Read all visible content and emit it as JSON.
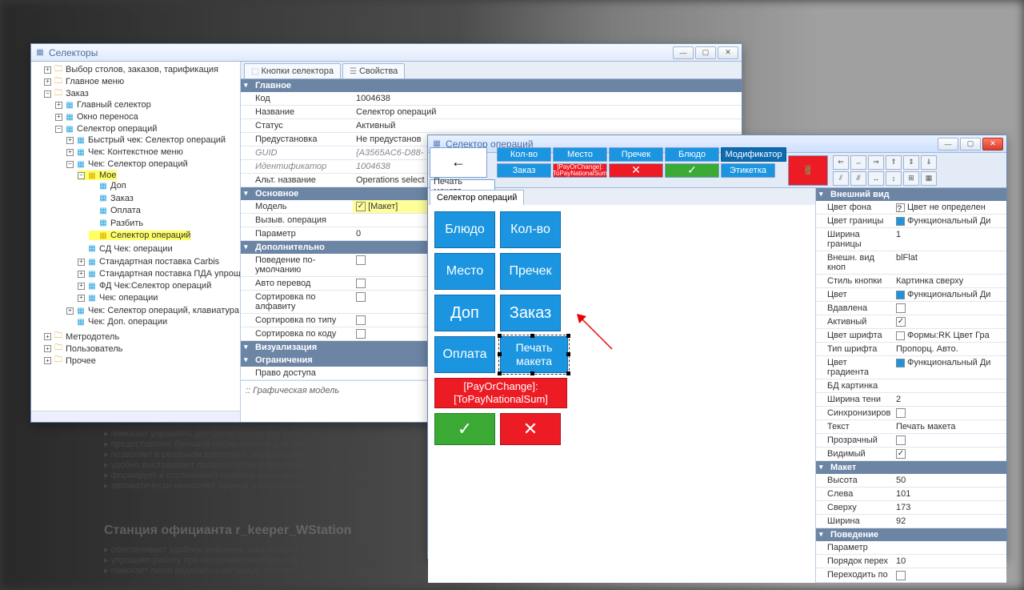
{
  "bg": {
    "bullets1": [
      "помогает управлять доступом персонала к кассовым операци",
      "предоставляет большой набор отчетов для ежедневного контр",
      "позволяет в реальном времени и по расписанию обновлять м",
      "удобно выстраивает правила оплаты по категориям блюд и го",
      "формирует и отслеживает правила начисления скидок",
      "автоматически начисляет премий и штрафы персоналу с учёт"
    ],
    "heading": "Станция официанта r_keeper_WStation",
    "bullets2": [
      "обеспечивает удобное внесение заказа через интуитивно-пон",
      "упрощает работу при обслуживании банкетов и перенос блюд м",
      "помогает легко поделить счет между гостями"
    ]
  },
  "win1": {
    "title": "Селекторы",
    "tree": {
      "n0": "Выбор столов, заказов, тарификация",
      "n1": "Главное меню",
      "n2": "Заказ",
      "n2_0": "Главный селектор",
      "n2_1": "Окно переноса",
      "n2_2": "Селектор операций",
      "n2_2_0": "Быстрый чек: Селектор операций",
      "n2_2_1": "Чек: Контекстное меню",
      "n2_2_2": "Чек: Селектор операций",
      "n2_2_2_0": "Мое",
      "n2_2_2_0_0": "Доп",
      "n2_2_2_0_1": "Заказ",
      "n2_2_2_0_2": "Оплата",
      "n2_2_2_0_3": "Разбить",
      "n2_2_2_0_4": "Селектор операций",
      "n2_2_3": "СД Чек: операции",
      "n2_2_4": "Стандартная поставка Carbis",
      "n2_2_5": "Стандартная поставка ПДА упрощ",
      "n2_2_6": "ФД Чек:Селектор операций",
      "n2_2_7": "Чек: операции",
      "n2_3": "Чек: Селектор операций, клавиатура",
      "n2_4": "Чек: Доп. операции",
      "n3": "Метродотель",
      "n4": "Пользователь",
      "n5": "Прочее"
    },
    "tabs": {
      "t0": "Кнопки селектора",
      "t1": "Свойства"
    },
    "props": {
      "sec_main": "Главное",
      "k_code": "Код",
      "v_code": "1004638",
      "k_name": "Название",
      "v_name": "Селектор операций",
      "k_status": "Статус",
      "v_status": "Активный",
      "k_preset": "Предустановка",
      "v_preset": "Не предустанов",
      "k_guid": "GUID",
      "v_guid": "{A3565AC6-D88-",
      "k_id": "Идентификатор",
      "v_id": "1004638",
      "k_alt": "Альт. название",
      "v_alt": "Operations select",
      "sec_main2": "Основное",
      "k_model": "Модель",
      "v_model": "[Макет]",
      "k_call": "Вызыв. операция",
      "k_param": "Параметр",
      "v_param": "0",
      "sec_extra": "Дополнительно",
      "k_def": "Поведение по-умолчанию",
      "k_auto": "Авто перевод",
      "k_sorta": "Сортировка по алфавиту",
      "k_sortt": "Сортировка по типу",
      "k_sortc": "Сортировка по коду",
      "sec_vis": "Визуализация",
      "sec_lim": "Ограничения",
      "k_access": "Право доступа",
      "graph": ":: Графическая модель"
    }
  },
  "win2": {
    "title": "Селектор операций",
    "toolbar": {
      "r0": {
        "b0": "←",
        "b1": "Кол-во",
        "b2": "Место",
        "b3": "Пречек",
        "b4": "Блюдо",
        "b5": "Модификатор",
        "b6_icon": "door"
      },
      "r1": {
        "b0": "Заказ",
        "b1": "[PayOrChange]:\n[ToPayNationalSum]",
        "b2": "✕",
        "b3": "✓",
        "b4": "Этикетка",
        "b5": "Печать макета"
      }
    },
    "canvas_tab": "Селектор операций",
    "canvas": {
      "b_dish": "Блюдо",
      "b_qty": "Кол-во",
      "b_place": "Место",
      "b_precheck": "Пречек",
      "b_dop": "Доп",
      "b_order": "Заказ",
      "b_pay": "Оплата",
      "b_print": "Печать\nмакета",
      "b_paych": "[PayOrChange]:\n[ToPayNationalSum]",
      "b_ok": "✓",
      "b_cancel": "✕"
    },
    "props": {
      "sec_appear": "Внешний вид",
      "k_bgcolor": "Цвет фона",
      "v_bgcolor": "Цвет не определен",
      "k_border": "Цвет границы",
      "v_border": "Функциональный Ди",
      "k_bw": "Ширина границы",
      "v_bw": "1",
      "k_bevel": "Внешн. вид кноп",
      "v_bevel": "blFlat",
      "k_bstyle": "Стиль кнопки",
      "v_bstyle": "Картинка сверху",
      "k_color": "Цвет",
      "v_color": "Функциональный Ди",
      "k_pressed": "Вдавлена",
      "k_active": "Активный",
      "k_fontc": "Цвет шрифта",
      "v_fontc": "Формы:RK Цвет Гра",
      "k_fontt": "Тип шрифта",
      "v_fontt": "Пропорц. Авто.",
      "k_grad": "Цвет градиента",
      "v_grad": "Функциональный Ди",
      "k_dbpic": "БД картинка",
      "k_shadow": "Ширина тени",
      "v_shadow": "2",
      "k_sync": "Синхронизиров",
      "k_text": "Текст",
      "v_text": "Печать макета",
      "k_trans": "Прозрачный",
      "k_vis": "Видимый",
      "sec_layout": "Макет",
      "k_h": "Высота",
      "v_h": "50",
      "k_l": "Слева",
      "v_l": "101",
      "k_t": "Сверху",
      "v_t": "173",
      "k_w": "Ширина",
      "v_w": "92",
      "sec_behav": "Поведение",
      "k_par": "Параметр",
      "k_tab": "Порядок перех",
      "v_tab": "10",
      "k_goto": "Переходить по"
    }
  }
}
